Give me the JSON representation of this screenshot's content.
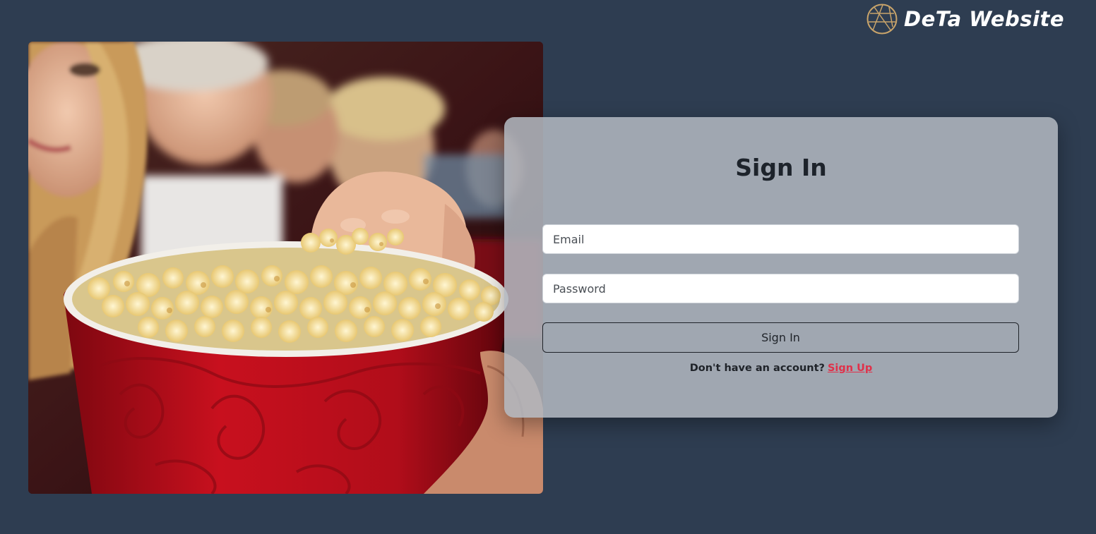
{
  "brand": {
    "name": "DeTa Website",
    "logo_icon": "globe-icon",
    "logo_color": "#c9a46a"
  },
  "hero": {
    "image_icon": "popcorn-cinema-photo",
    "colors": {
      "bucket_red": "#c8101e",
      "popcorn": "#f3df9a",
      "background": "#2a1012"
    }
  },
  "signin": {
    "title": "Sign In",
    "email_placeholder": "Email",
    "email_value": "",
    "password_placeholder": "Password",
    "password_value": "",
    "submit_label": "Sign In",
    "prompt_text": "Don't have an account?",
    "signup_link": "Sign Up"
  },
  "theme": {
    "page_background": "#2e3d51",
    "card_background": "#b0b6be",
    "link_color": "#e0314a",
    "text_dark": "#1d232b"
  }
}
